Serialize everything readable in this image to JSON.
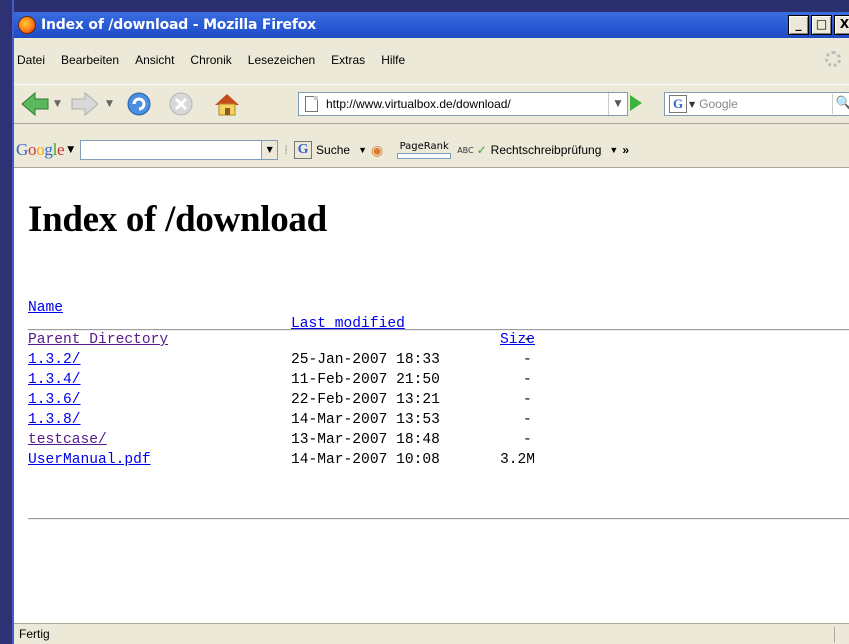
{
  "window": {
    "title": "Index of /download - Mozilla Firefox",
    "min": "_",
    "max": "□",
    "close": "X"
  },
  "menu": [
    "Datei",
    "Bearbeiten",
    "Ansicht",
    "Chronik",
    "Lesezeichen",
    "Extras",
    "Hilfe"
  ],
  "nav": {
    "url": "http://www.virtualbox.de/download/",
    "search_placeholder": "Google"
  },
  "google_toolbar": {
    "logo": "Google",
    "search_label": "Suche",
    "pagerank": "PageRank",
    "abc": "ABC",
    "spellcheck": "Rechtschreibprüfung",
    "more": "»"
  },
  "page": {
    "heading": "Index of /download",
    "columns": {
      "name": "Name",
      "modified": "Last modified",
      "size": "Size"
    },
    "rows": [
      {
        "name": "Parent Directory",
        "modified": "",
        "size": "-",
        "visited": true
      },
      {
        "name": "1.3.2/",
        "modified": "25-Jan-2007 18:33",
        "size": "-",
        "visited": false
      },
      {
        "name": "1.3.4/",
        "modified": "11-Feb-2007 21:50",
        "size": "-",
        "visited": false
      },
      {
        "name": "1.3.6/",
        "modified": "22-Feb-2007 13:21",
        "size": "-",
        "visited": false
      },
      {
        "name": "1.3.8/",
        "modified": "14-Mar-2007 13:53",
        "size": "-",
        "visited": false
      },
      {
        "name": "testcase/",
        "modified": "13-Mar-2007 18:48",
        "size": "-",
        "visited": true
      },
      {
        "name": "UserManual.pdf",
        "modified": "14-Mar-2007 10:08",
        "size": "3.2M",
        "visited": false
      }
    ]
  },
  "status": "Fertig"
}
